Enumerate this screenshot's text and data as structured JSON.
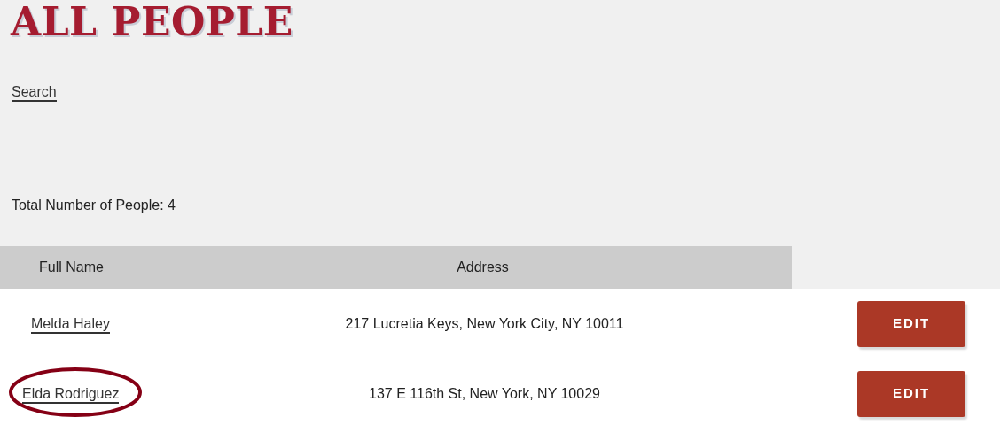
{
  "title": "ALL PEOPLE",
  "search_link": "Search",
  "total": "Total Number of People: 4",
  "table": {
    "columns": [
      "Full Name",
      "Address"
    ],
    "rows": [
      {
        "name": "Melda Haley",
        "address": "217 Lucretia Keys, New York City, NY 10011",
        "button": "EDIT",
        "circled": false
      },
      {
        "name": "Elda Rodriguez",
        "address": "137 E 116th St, New York, NY 10029",
        "button": "EDIT",
        "circled": true
      }
    ]
  }
}
